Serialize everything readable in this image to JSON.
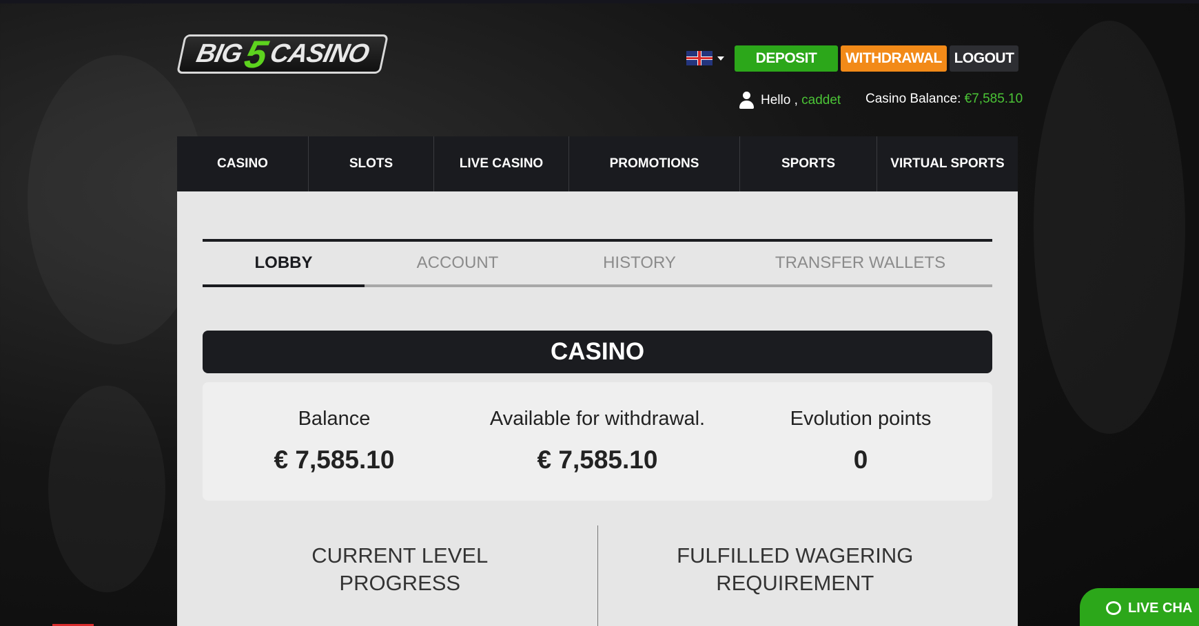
{
  "brand": {
    "logo_pre": "BIG",
    "logo_num": "5",
    "logo_post": "CASINO"
  },
  "header": {
    "deposit_label": "DEPOSIT",
    "withdraw_label": "WITHDRAWAL",
    "logout_label": "LOGOUT",
    "greeting": "Hello ,",
    "username": "caddet",
    "balance_label": "Casino Balance:",
    "balance_value": "€7,585.10"
  },
  "nav": [
    "CASINO",
    "SLOTS",
    "LIVE CASINO",
    "PROMOTIONS",
    "SPORTS",
    "VIRTUAL SPORTS"
  ],
  "tabs": [
    "LOBBY",
    "ACCOUNT",
    "HISTORY",
    "TRANSFER WALLETS"
  ],
  "section_title": "CASINO",
  "stats": [
    {
      "label": "Balance",
      "value": "€ 7,585.10"
    },
    {
      "label": "Available for withdrawal.",
      "value": "€ 7,585.10"
    },
    {
      "label": "Evolution points",
      "value": "0"
    }
  ],
  "lower": {
    "left_line1": "CURRENT LEVEL",
    "left_line2": "PROGRESS",
    "right_line1": "FULFILLED WAGERING",
    "right_line2": "REQUIREMENT"
  },
  "live_chat_label": "LIVE CHA",
  "colors": {
    "green": "#2ca71a",
    "orange": "#f28a18",
    "dark": "#1b1c20"
  },
  "icons": {
    "flag": "uk-flag-icon",
    "user": "user-icon",
    "chat": "chat-icon"
  }
}
